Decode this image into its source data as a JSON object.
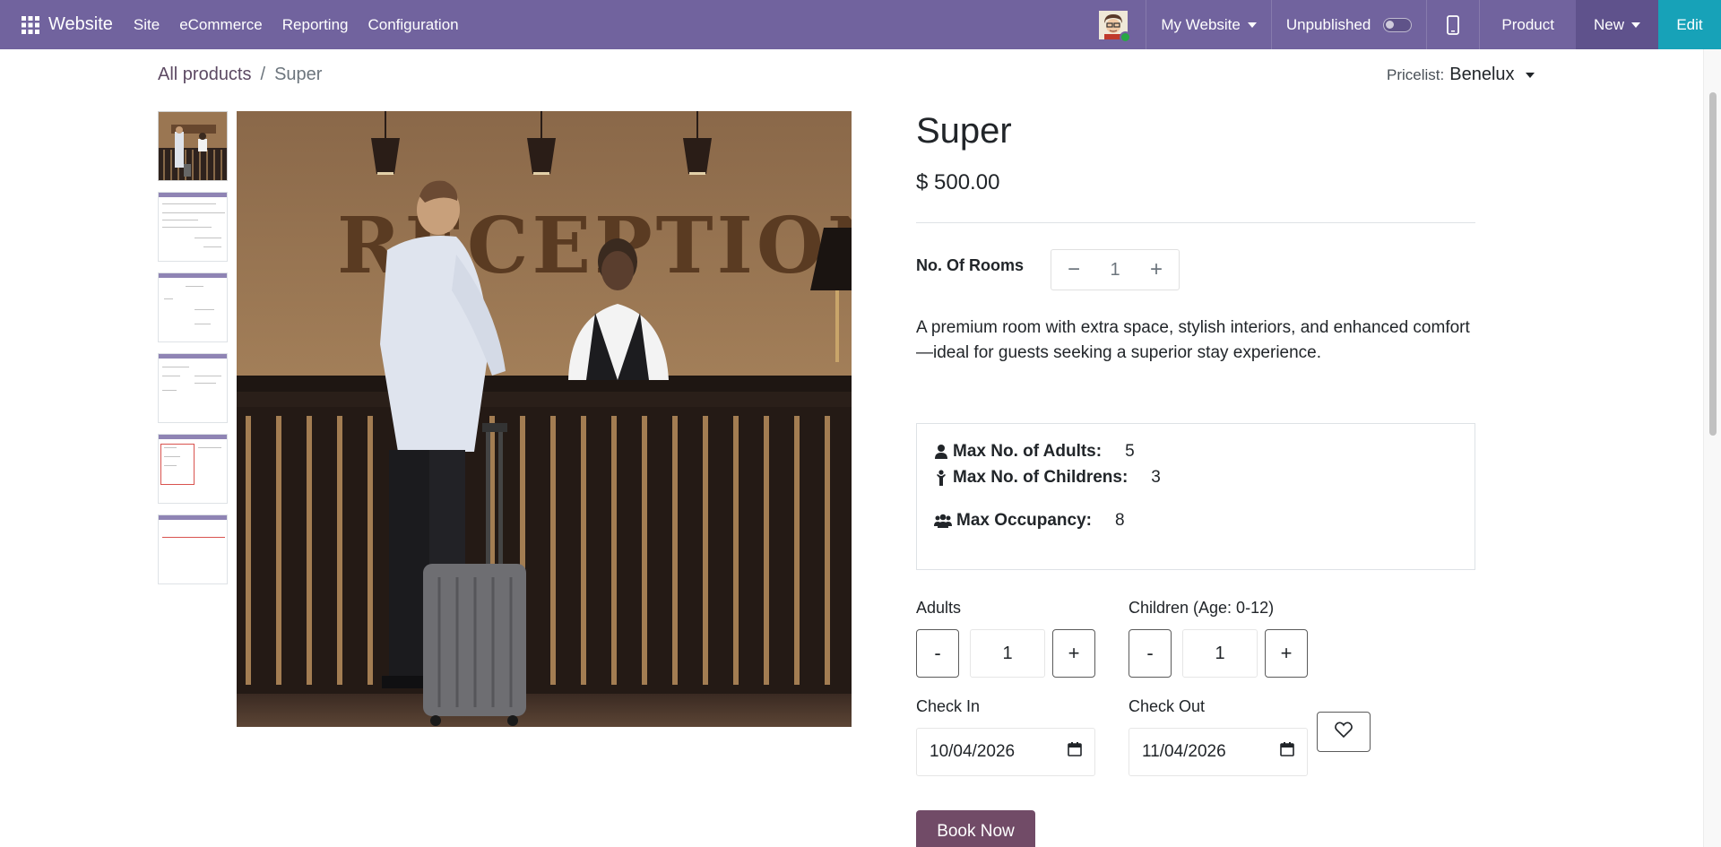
{
  "topbar": {
    "brand": "Website",
    "menu": [
      "Site",
      "eCommerce",
      "Reporting",
      "Configuration"
    ],
    "website_selector": "My Website",
    "publish_status": "Unpublished",
    "product_label": "Product",
    "new_label": "New",
    "edit_label": "Edit",
    "colors": {
      "bar": "#71639e",
      "edit": "#17a2b8"
    }
  },
  "breadcrumb": {
    "parent": "All products",
    "separator": "/",
    "current": "Super"
  },
  "pricelist": {
    "label": "Pricelist:",
    "value": "Benelux"
  },
  "product": {
    "name": "Super",
    "price": "$ 500.00",
    "rooms_label": "No. Of Rooms",
    "rooms_minus": "−",
    "rooms_value": "1",
    "rooms_plus": "+",
    "description": "A premium room with extra space, stylish interiors, and enhanced comfort—ideal for guests seeking a superior stay experience."
  },
  "capacity": {
    "adults_label": "Max No. of Adults:",
    "adults_value": "5",
    "children_label": "Max No. of Childrens:",
    "children_value": "3",
    "occupancy_label": "Max Occupancy:",
    "occupancy_value": "8"
  },
  "booking": {
    "adults_label": "Adults",
    "adults_value": "1",
    "children_label": "Children (Age: 0-12)",
    "children_value": "1",
    "minus": "-",
    "plus": "+",
    "checkin_label": "Check In",
    "checkin_value": "10/04/2026",
    "checkout_label": "Check Out",
    "checkout_value": "11/04/2026",
    "book_label": "Book Now",
    "book_color": "#714b67"
  },
  "image": {
    "sign_text": "RECEPTION"
  }
}
